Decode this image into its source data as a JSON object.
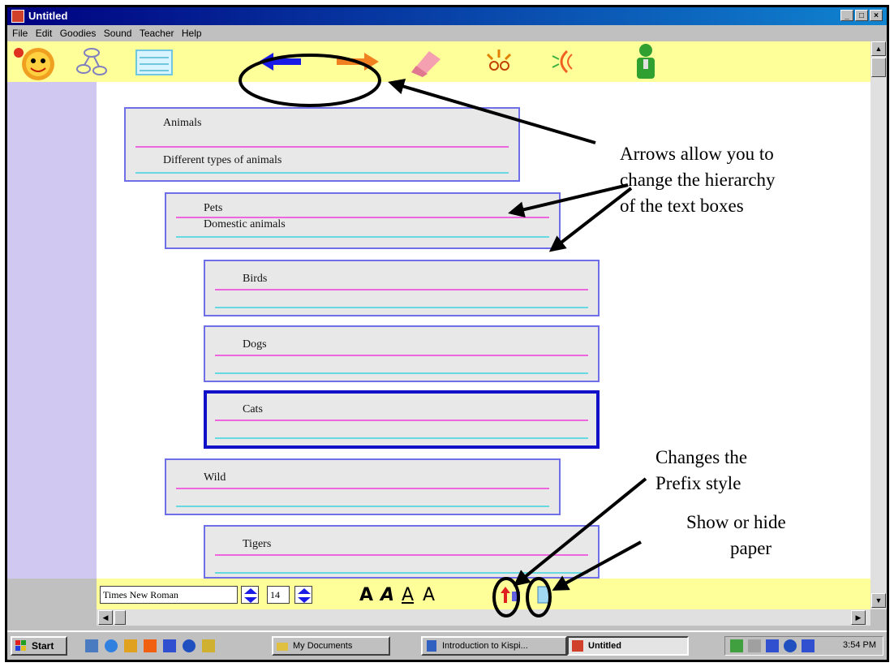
{
  "window": {
    "title": "Untitled",
    "controls": [
      "_",
      "□",
      "×"
    ]
  },
  "menu": [
    "File",
    "Edit",
    "Goodies",
    "Sound",
    "Teacher",
    "Help"
  ],
  "toolbar": {
    "tools": [
      "mascot-icon",
      "diagram-view-icon",
      "outline-view-icon",
      "move-left-arrow-icon",
      "move-right-arrow-icon",
      "eraser-icon",
      "rapidfire-icon",
      "sound-icon",
      "teacher-figure-icon"
    ],
    "colors": {
      "background": "#ffff99",
      "blue_arrow": "#1a1ae6",
      "orange_arrow": "#f08020"
    }
  },
  "outline": [
    {
      "title": "Animals",
      "note": "Different types of animals",
      "level": 0
    },
    {
      "title": "Pets",
      "note": "Domestic animals",
      "level": 1
    },
    {
      "title": "Birds",
      "note": "",
      "level": 2
    },
    {
      "title": "Dogs",
      "note": "",
      "level": 2
    },
    {
      "title": "Cats",
      "note": "",
      "level": 2,
      "selected": true
    },
    {
      "title": "Wild",
      "note": "",
      "level": 1
    },
    {
      "title": "Tigers",
      "note": "",
      "level": 2
    }
  ],
  "font_bar": {
    "font": "Times New Roman",
    "size": "14",
    "format_buttons": [
      "A",
      "A",
      "A",
      "A"
    ]
  },
  "annotations": {
    "arrows_note": [
      "Arrows allow you to",
      "change the hierarchy",
      "of the text boxes"
    ],
    "prefix_note": [
      "Changes the",
      "Prefix style"
    ],
    "paper_note": [
      "Show or hide",
      "paper"
    ]
  },
  "taskbar": {
    "start": "Start",
    "buttons": [
      "My Documents",
      "Introduction to Kispi...",
      "Untitled"
    ],
    "clock": "3:54 PM"
  }
}
